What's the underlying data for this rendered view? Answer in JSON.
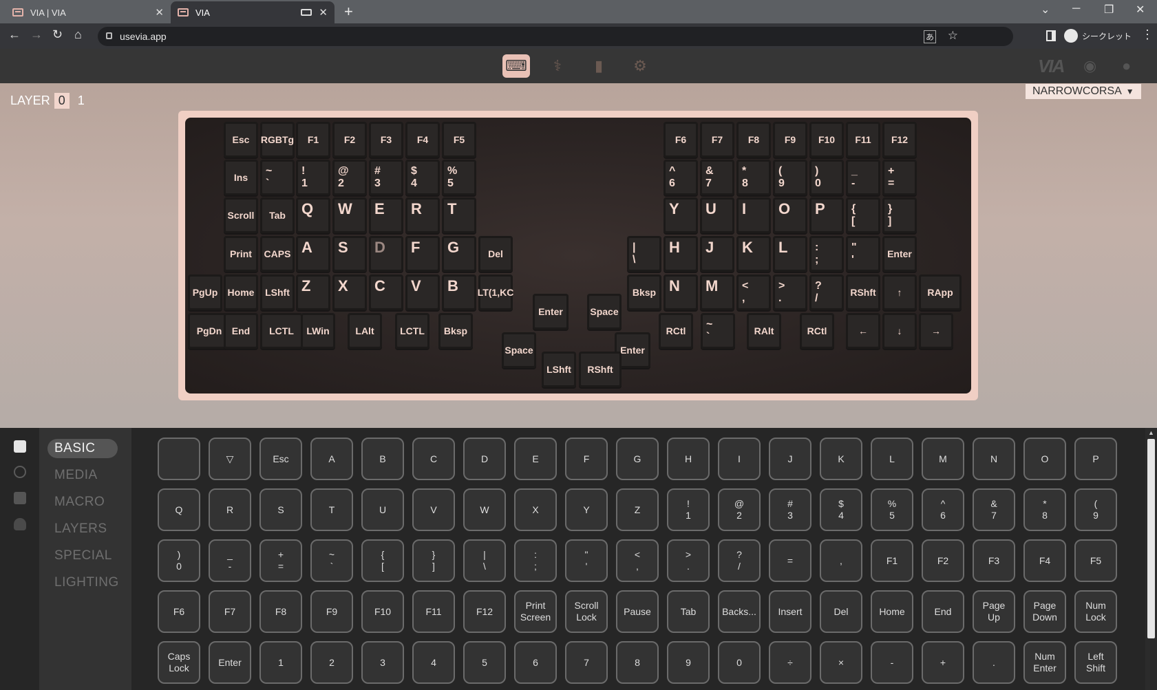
{
  "browser": {
    "tabs": [
      {
        "title": "VIA | VIA",
        "active": false
      },
      {
        "title": "VIA",
        "active": true
      }
    ],
    "url": "usevia.app",
    "incognito_label": "シークレット"
  },
  "via": {
    "layer_label": "LAYER",
    "layers": [
      "0",
      "1"
    ],
    "selected_layer": "0",
    "keyboard_name": "NARROWCORSA",
    "logo": "VIA",
    "keys": [
      {
        "label": "Esc"
      },
      {
        "label": "RGBTg"
      },
      {
        "label": "F1"
      },
      {
        "label": "F2"
      },
      {
        "label": "F3"
      },
      {
        "label": "F4"
      },
      {
        "label": "F5"
      },
      {
        "label": "F6"
      },
      {
        "label": "F7"
      },
      {
        "label": "F8"
      },
      {
        "label": "F9"
      },
      {
        "label": "F10"
      },
      {
        "label": "F11"
      },
      {
        "label": "F12"
      },
      {
        "label": "Ins"
      },
      {
        "top": "~",
        "bottom": "`"
      },
      {
        "top": "!",
        "bottom": "1"
      },
      {
        "top": "@",
        "bottom": "2"
      },
      {
        "top": "#",
        "bottom": "3"
      },
      {
        "top": "$",
        "bottom": "4"
      },
      {
        "top": "%",
        "bottom": "5"
      },
      {
        "top": "^",
        "bottom": "6"
      },
      {
        "top": "&",
        "bottom": "7"
      },
      {
        "top": "*",
        "bottom": "8"
      },
      {
        "top": "(",
        "bottom": "9"
      },
      {
        "top": ")",
        "bottom": "0"
      },
      {
        "top": "_",
        "bottom": "-"
      },
      {
        "top": "+",
        "bottom": "="
      },
      {
        "label": "Scroll"
      },
      {
        "label": "Tab"
      },
      {
        "label": "Q"
      },
      {
        "label": "W"
      },
      {
        "label": "E"
      },
      {
        "label": "R"
      },
      {
        "label": "T"
      },
      {
        "label": "Y"
      },
      {
        "label": "U"
      },
      {
        "label": "I"
      },
      {
        "label": "O"
      },
      {
        "label": "P"
      },
      {
        "top": "{",
        "bottom": "["
      },
      {
        "top": "}",
        "bottom": "]"
      },
      {
        "label": "Print"
      },
      {
        "label": "CAPS"
      },
      {
        "label": "A"
      },
      {
        "label": "S"
      },
      {
        "label": "D"
      },
      {
        "label": "F"
      },
      {
        "label": "G"
      },
      {
        "label": "Del"
      },
      {
        "top": "|",
        "bottom": "\\"
      },
      {
        "label": "H"
      },
      {
        "label": "J"
      },
      {
        "label": "K"
      },
      {
        "label": "L"
      },
      {
        "top": ":",
        "bottom": ";"
      },
      {
        "top": "\"",
        "bottom": "'"
      },
      {
        "label": "Enter"
      },
      {
        "label": "PgUp"
      },
      {
        "label": "Home"
      },
      {
        "label": "LShft"
      },
      {
        "label": "Z"
      },
      {
        "label": "X"
      },
      {
        "label": "C"
      },
      {
        "label": "V"
      },
      {
        "label": "B"
      },
      {
        "label": "LT(1,KC"
      },
      {
        "label": "Bksp"
      },
      {
        "label": "N"
      },
      {
        "label": "M"
      },
      {
        "top": "<",
        "bottom": ","
      },
      {
        "top": ">",
        "bottom": "."
      },
      {
        "top": "?",
        "bottom": "/"
      },
      {
        "label": "RShft"
      },
      {
        "label": "↑"
      },
      {
        "label": "RApp"
      },
      {
        "label": "PgDn"
      },
      {
        "label": "End"
      },
      {
        "label": "LCTL"
      },
      {
        "label": "LWin"
      },
      {
        "label": "LAlt"
      },
      {
        "label": "LCTL"
      },
      {
        "label": "Bksp"
      },
      {
        "label": "Enter"
      },
      {
        "label": "Space"
      },
      {
        "label": "Space"
      },
      {
        "label": "Enter"
      },
      {
        "label": "LShft"
      },
      {
        "label": "RShft"
      },
      {
        "label": "RCtl"
      },
      {
        "top": "~",
        "bottom": "`"
      },
      {
        "label": "RAlt"
      },
      {
        "label": "RCtl"
      },
      {
        "label": "←"
      },
      {
        "label": "↓"
      },
      {
        "label": "→"
      }
    ],
    "categories": [
      "BASIC",
      "MEDIA",
      "MACRO",
      "LAYERS",
      "SPECIAL",
      "LIGHTING"
    ],
    "selected_category": "BASIC",
    "keycodes": [
      "",
      "▽",
      "Esc",
      "A",
      "B",
      "C",
      "D",
      "E",
      "F",
      "G",
      "H",
      "I",
      "J",
      "K",
      "L",
      "M",
      "N",
      "O",
      "P",
      "Q",
      "R",
      "S",
      "T",
      "U",
      "V",
      "W",
      "X",
      "Y",
      "Z",
      "!\n1",
      "@\n2",
      "#\n3",
      "$\n4",
      "%\n5",
      "^\n6",
      "&\n7",
      "*\n8",
      "(\n9",
      ")\n0",
      "_\n-",
      "+\n=",
      "~\n`",
      "{\n[",
      "}\n]",
      "|\n\\",
      ":\n;",
      "\"\n'",
      "<\n,",
      ">\n.",
      "?\n/",
      "=",
      ",",
      "F1",
      "F2",
      "F3",
      "F4",
      "F5",
      "F6",
      "F7",
      "F8",
      "F9",
      "F10",
      "F11",
      "F12",
      "Print\nScreen",
      "Scroll\nLock",
      "Pause",
      "Tab",
      "Backs...",
      "Insert",
      "Del",
      "Home",
      "End",
      "Page\nUp",
      "Page\nDown",
      "Num\nLock",
      "Caps\nLock",
      "Enter",
      "1",
      "2",
      "3",
      "4",
      "5",
      "6",
      "7",
      "8",
      "9",
      "0",
      "÷",
      "×",
      "-",
      "+",
      ".",
      "Num\nEnter",
      "Left\nShift"
    ]
  }
}
